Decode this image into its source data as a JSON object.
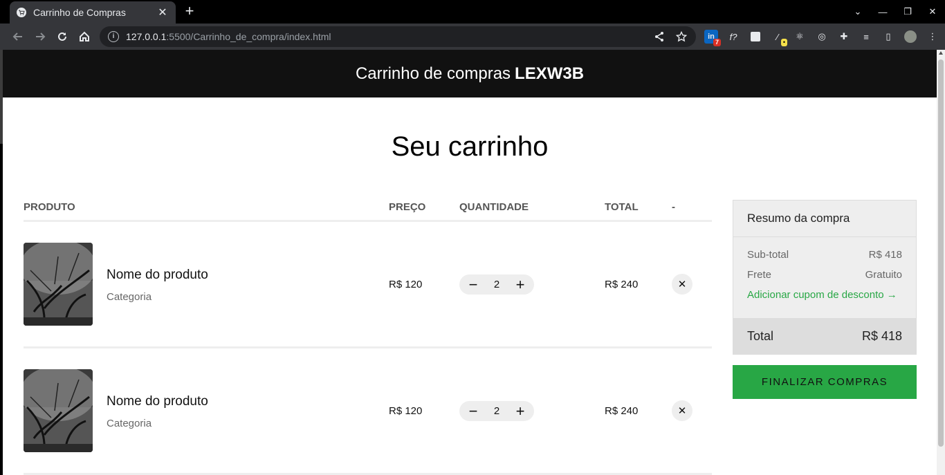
{
  "browser": {
    "tab_title": "Carrinho de Compras",
    "tab_close": "✕",
    "new_tab": "+",
    "url_host": "127.0.0.1",
    "url_rest": ":5500/Carrinho_de_compra/index.html",
    "extensions": [
      {
        "icon": "in",
        "badge": "7"
      },
      {
        "icon": "f?",
        "badge": ""
      },
      {
        "icon": "sheet",
        "badge": ""
      },
      {
        "icon": "pen",
        "badge": "•"
      }
    ]
  },
  "header": {
    "title": "Carrinho de compras",
    "brand": "LEXW3B"
  },
  "main": {
    "title": "Seu carrinho",
    "columns": [
      "PRODUTO",
      "PREÇO",
      "QUANTIDADE",
      "TOTAL",
      "-"
    ]
  },
  "cart_items": [
    {
      "name": "Nome do produto",
      "category": "Categoria",
      "price": "R$ 120",
      "qty": "2",
      "total": "R$ 240",
      "minus": "−",
      "plus": "+",
      "remove": "✕"
    },
    {
      "name": "Nome do produto",
      "category": "Categoria",
      "price": "R$ 120",
      "qty": "2",
      "total": "R$ 240",
      "minus": "−",
      "plus": "+",
      "remove": "✕"
    }
  ],
  "summary": {
    "title": "Resumo da compra",
    "subtotal_label": "Sub-total",
    "subtotal_value": "R$ 418",
    "shipping_label": "Frete",
    "shipping_value": "Gratuito",
    "coupon_label": "Adicionar cupom de desconto →",
    "total_label": "Total",
    "total_value": "R$ 418",
    "checkout_label": "Finalizar compras",
    "accent_color": "#28a745"
  }
}
